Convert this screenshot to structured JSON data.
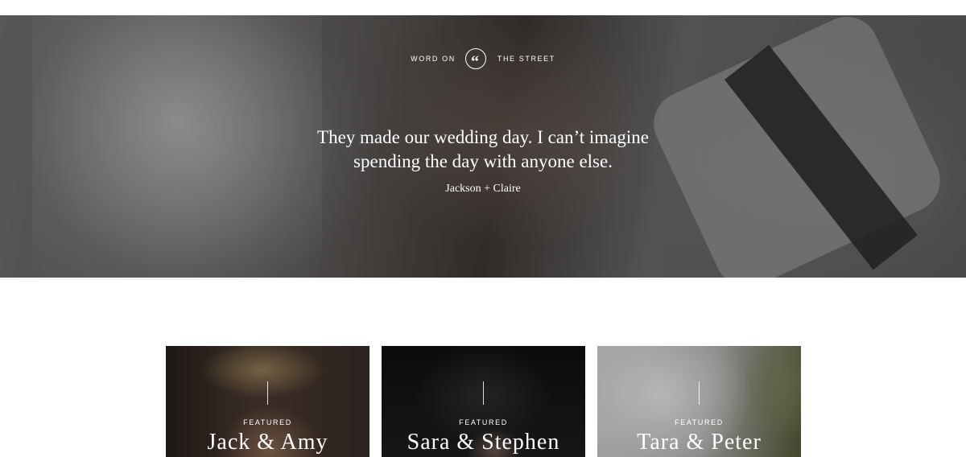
{
  "hero": {
    "eyebrow_left": "WORD ON",
    "eyebrow_icon": "quote-icon",
    "eyebrow_right": "THE STREET",
    "quote_line1": "They made our wedding day. I can’t imagine",
    "quote_line2": "spending the day with anyone else.",
    "author": "Jackson + Claire"
  },
  "cards": [
    {
      "label": "FEATURED",
      "name": "Jack & Amy"
    },
    {
      "label": "FEATURED",
      "name": "Sara & Stephen"
    },
    {
      "label": "FEATURED",
      "name": "Tara & Peter"
    }
  ],
  "colors": {
    "text_light": "#ffffff",
    "page_background": "#ffffff"
  }
}
